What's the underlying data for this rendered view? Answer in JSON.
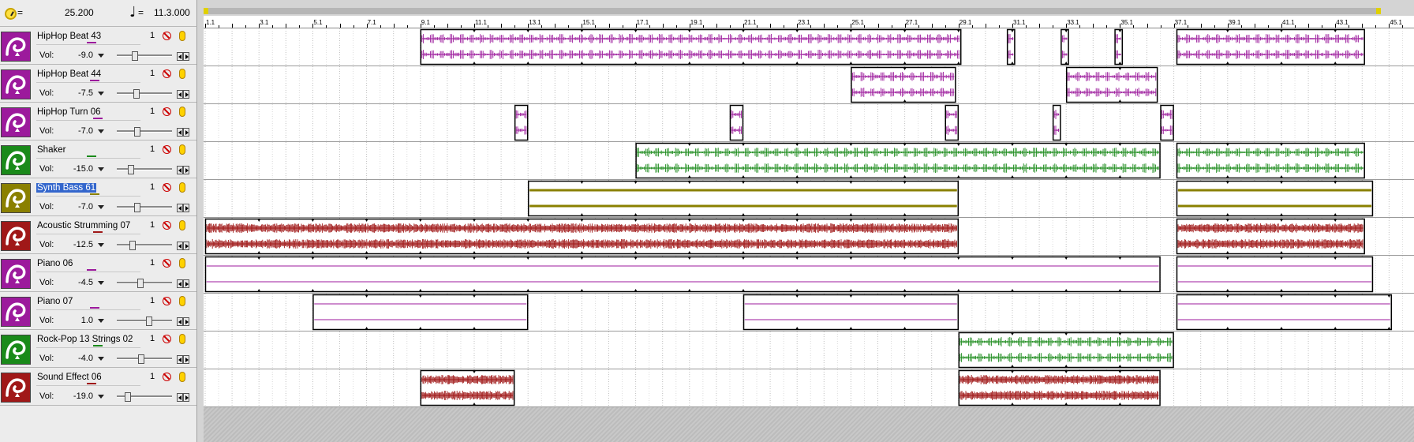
{
  "transport": {
    "tempo_icon": "metronome-icon",
    "tempo_eq": "=",
    "tempo_value": "25.200",
    "note_icon": "quarter-note-icon",
    "note_glyph": "♩",
    "note_eq": "=",
    "position_value": "11.3.000"
  },
  "ruler": {
    "labels": [
      "1.1",
      "3.1",
      "5.1",
      "7.1",
      "9.1",
      "11.1",
      "13.1",
      "15.1",
      "17.1",
      "19.1",
      "21.1",
      "23.1",
      "25.1",
      "27.1",
      "29.1",
      "31.1",
      "33.1",
      "35.1",
      "37.1",
      "39.1",
      "41.1",
      "43.1",
      "45.1"
    ]
  },
  "tracks": [
    {
      "name": "HipHop Beat 43",
      "number": "1",
      "vol_label": "Vol:",
      "vol": "-9.0",
      "fader": 0.3,
      "color": "#9c1a9c",
      "selected": false,
      "clips": [
        {
          "start": 9,
          "end": 29.1
        },
        {
          "start": 30.8,
          "end": 31.1
        },
        {
          "start": 32.8,
          "end": 33.1
        },
        {
          "start": 34.8,
          "end": 35.1
        },
        {
          "start": 37.1,
          "end": 44.1
        }
      ]
    },
    {
      "name": "HipHop Beat 44",
      "number": "1",
      "vol_label": "Vol:",
      "vol": "-7.5",
      "fader": 0.34,
      "color": "#9c1a9c",
      "selected": false,
      "clips": [
        {
          "start": 25,
          "end": 28.9
        },
        {
          "start": 33,
          "end": 36.4
        }
      ]
    },
    {
      "name": "HipHop Turn 06",
      "number": "1",
      "vol_label": "Vol:",
      "vol": "-7.0",
      "fader": 0.36,
      "color": "#9c1a9c",
      "selected": false,
      "clips": [
        {
          "start": 12.5,
          "end": 13
        },
        {
          "start": 20.5,
          "end": 21
        },
        {
          "start": 28.5,
          "end": 29
        },
        {
          "start": 32.5,
          "end": 32.8
        },
        {
          "start": 36.5,
          "end": 37
        }
      ]
    },
    {
      "name": "Shaker",
      "number": "1",
      "vol_label": "Vol:",
      "vol": "-15.0",
      "fader": 0.22,
      "color": "#1a8a1a",
      "selected": false,
      "clips": [
        {
          "start": 17,
          "end": 36.5
        },
        {
          "start": 37.1,
          "end": 44.1
        }
      ]
    },
    {
      "name": "Synth Bass 61",
      "number": "1",
      "vol_label": "Vol:",
      "vol": "-7.0",
      "fader": 0.36,
      "color": "#8a8000",
      "selected": true,
      "clips": [
        {
          "start": 13,
          "end": 29
        },
        {
          "start": 37.1,
          "end": 44.4
        }
      ]
    },
    {
      "name": "Acoustic Strumming 07",
      "number": "1",
      "vol_label": "Vol:",
      "vol": "-12.5",
      "fader": 0.26,
      "color": "#a01818",
      "selected": false,
      "clips": [
        {
          "start": 1,
          "end": 29
        },
        {
          "start": 37.1,
          "end": 44.1
        }
      ]
    },
    {
      "name": "Piano 06",
      "number": "1",
      "vol_label": "Vol:",
      "vol": "-4.5",
      "fader": 0.42,
      "color": "#9c1a9c",
      "selected": false,
      "clips": [
        {
          "start": 1,
          "end": 36.5
        },
        {
          "start": 37.1,
          "end": 44.4
        }
      ]
    },
    {
      "name": "Piano 07",
      "number": "1",
      "vol_label": "Vol:",
      "vol": "1.0",
      "fader": 0.6,
      "color": "#9c1a9c",
      "selected": false,
      "clips": [
        {
          "start": 5,
          "end": 13
        },
        {
          "start": 21,
          "end": 29
        },
        {
          "start": 37.1,
          "end": 45.1
        }
      ]
    },
    {
      "name": "Rock-Pop 13 Strings 02",
      "number": "1",
      "vol_label": "Vol:",
      "vol": "-4.0",
      "fader": 0.43,
      "color": "#1a8a1a",
      "selected": false,
      "clips": [
        {
          "start": 29,
          "end": 37
        }
      ]
    },
    {
      "name": "Sound Effect 06",
      "number": "1",
      "vol_label": "Vol:",
      "vol": "-19.0",
      "fader": 0.16,
      "color": "#a01818",
      "selected": false,
      "clips": [
        {
          "start": 9,
          "end": 12.5
        },
        {
          "start": 29,
          "end": 36.5
        }
      ]
    }
  ]
}
